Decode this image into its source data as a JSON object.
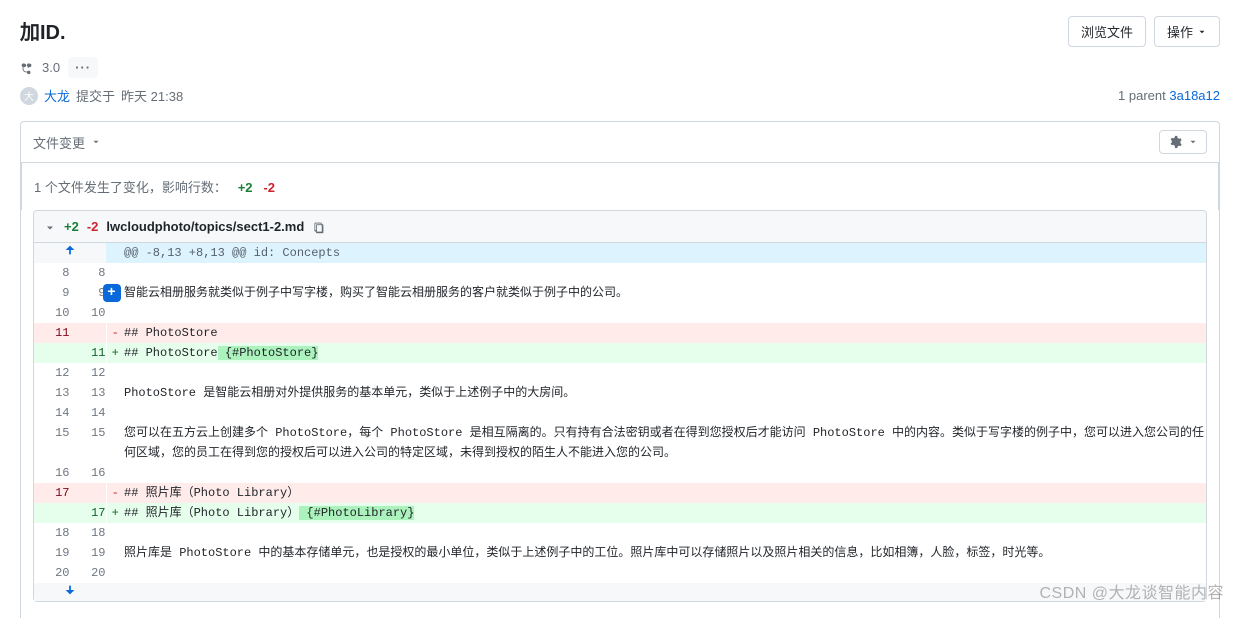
{
  "header": {
    "title": "加ID.",
    "browse_files": "浏览文件",
    "actions": "操作"
  },
  "branch": {
    "name": "3.0"
  },
  "commit": {
    "author": "大龙",
    "committed_label": "提交于",
    "time": "昨天 21:38",
    "parent_label": "1 parent",
    "parent_sha": "3a18a12"
  },
  "tabs": {
    "file_changes": "文件变更"
  },
  "summary": {
    "text_prefix": "1 个文件发生了变化，影响行数：",
    "additions": "+2",
    "deletions": "-2"
  },
  "file": {
    "additions": "+2",
    "deletions": "-2",
    "path": "lwcloudphoto/topics/sect1-2.md"
  },
  "diff": {
    "hunk_header": "@@ -8,13 +8,13 @@ id: Concepts",
    "rows": [
      {
        "type": "context",
        "old": "8",
        "new": "8",
        "text": ""
      },
      {
        "type": "context",
        "old": "9",
        "new": "9",
        "text": "智能云相册服务就类似于例子中写字楼，购买了智能云相册服务的客户就类似于例子中的公司。"
      },
      {
        "type": "context",
        "old": "10",
        "new": "10",
        "text": ""
      },
      {
        "type": "del",
        "old": "11",
        "new": "",
        "text": "## PhotoStore"
      },
      {
        "type": "add",
        "old": "",
        "new": "11",
        "text_pre": "## PhotoStore",
        "text_hl": " {#PhotoStore}"
      },
      {
        "type": "context",
        "old": "12",
        "new": "12",
        "text": ""
      },
      {
        "type": "context",
        "old": "13",
        "new": "13",
        "text": "PhotoStore 是智能云相册对外提供服务的基本单元，类似于上述例子中的大房间。"
      },
      {
        "type": "context",
        "old": "14",
        "new": "14",
        "text": ""
      },
      {
        "type": "context",
        "old": "15",
        "new": "15",
        "text": "您可以在五方云上创建多个 PhotoStore，每个 PhotoStore 是相互隔离的。只有持有合法密钥或者在得到您授权后才能访问 PhotoStore 中的内容。类似于写字楼的例子中，您可以进入您公司的任何区域，您的员工在得到您的授权后可以进入公司的特定区域，未得到授权的陌生人不能进入您的公司。"
      },
      {
        "type": "context",
        "old": "16",
        "new": "16",
        "text": ""
      },
      {
        "type": "del",
        "old": "17",
        "new": "",
        "text": "## 照片库（Photo Library）"
      },
      {
        "type": "add",
        "old": "",
        "new": "17",
        "text_pre": "## 照片库（Photo Library）",
        "text_hl": " {#PhotoLibrary}"
      },
      {
        "type": "context",
        "old": "18",
        "new": "18",
        "text": ""
      },
      {
        "type": "context",
        "old": "19",
        "new": "19",
        "text": "照片库是 PhotoStore 中的基本存储单元，也是授权的最小单位，类似于上述例子中的工位。照片库中可以存储照片以及照片相关的信息，比如相簿，人脸，标签，时光等。"
      },
      {
        "type": "context",
        "old": "20",
        "new": "20",
        "text": ""
      }
    ]
  },
  "watermark": "CSDN @大龙谈智能内容"
}
